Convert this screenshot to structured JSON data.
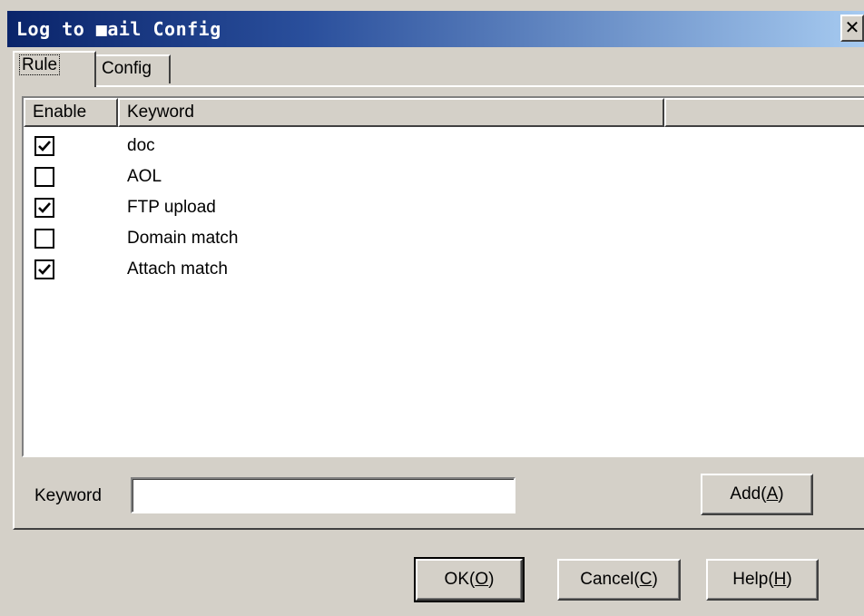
{
  "window": {
    "title": "Log to ■ail Config",
    "close_glyph": "✕"
  },
  "tabs": [
    {
      "label": "Rule",
      "active": true
    },
    {
      "label": "Config",
      "active": false
    }
  ],
  "list": {
    "columns": [
      "Enable",
      "Keyword",
      ""
    ],
    "rows": [
      {
        "enabled": true,
        "keyword": "doc"
      },
      {
        "enabled": false,
        "keyword": "AOL"
      },
      {
        "enabled": true,
        "keyword": "FTP upload"
      },
      {
        "enabled": false,
        "keyword": "Domain match"
      },
      {
        "enabled": true,
        "keyword": "Attach match"
      }
    ]
  },
  "keyword_field": {
    "label": "Keyword",
    "value": ""
  },
  "buttons": {
    "add": {
      "text": "Add(",
      "key": "A",
      "end": ")"
    },
    "ok": {
      "text": "OK(",
      "key": "O",
      "end": ")"
    },
    "cancel": {
      "text": "Cancel(",
      "key": "C",
      "end": ")"
    },
    "help": {
      "text": "Help(",
      "key": "H",
      "end": ")"
    }
  }
}
